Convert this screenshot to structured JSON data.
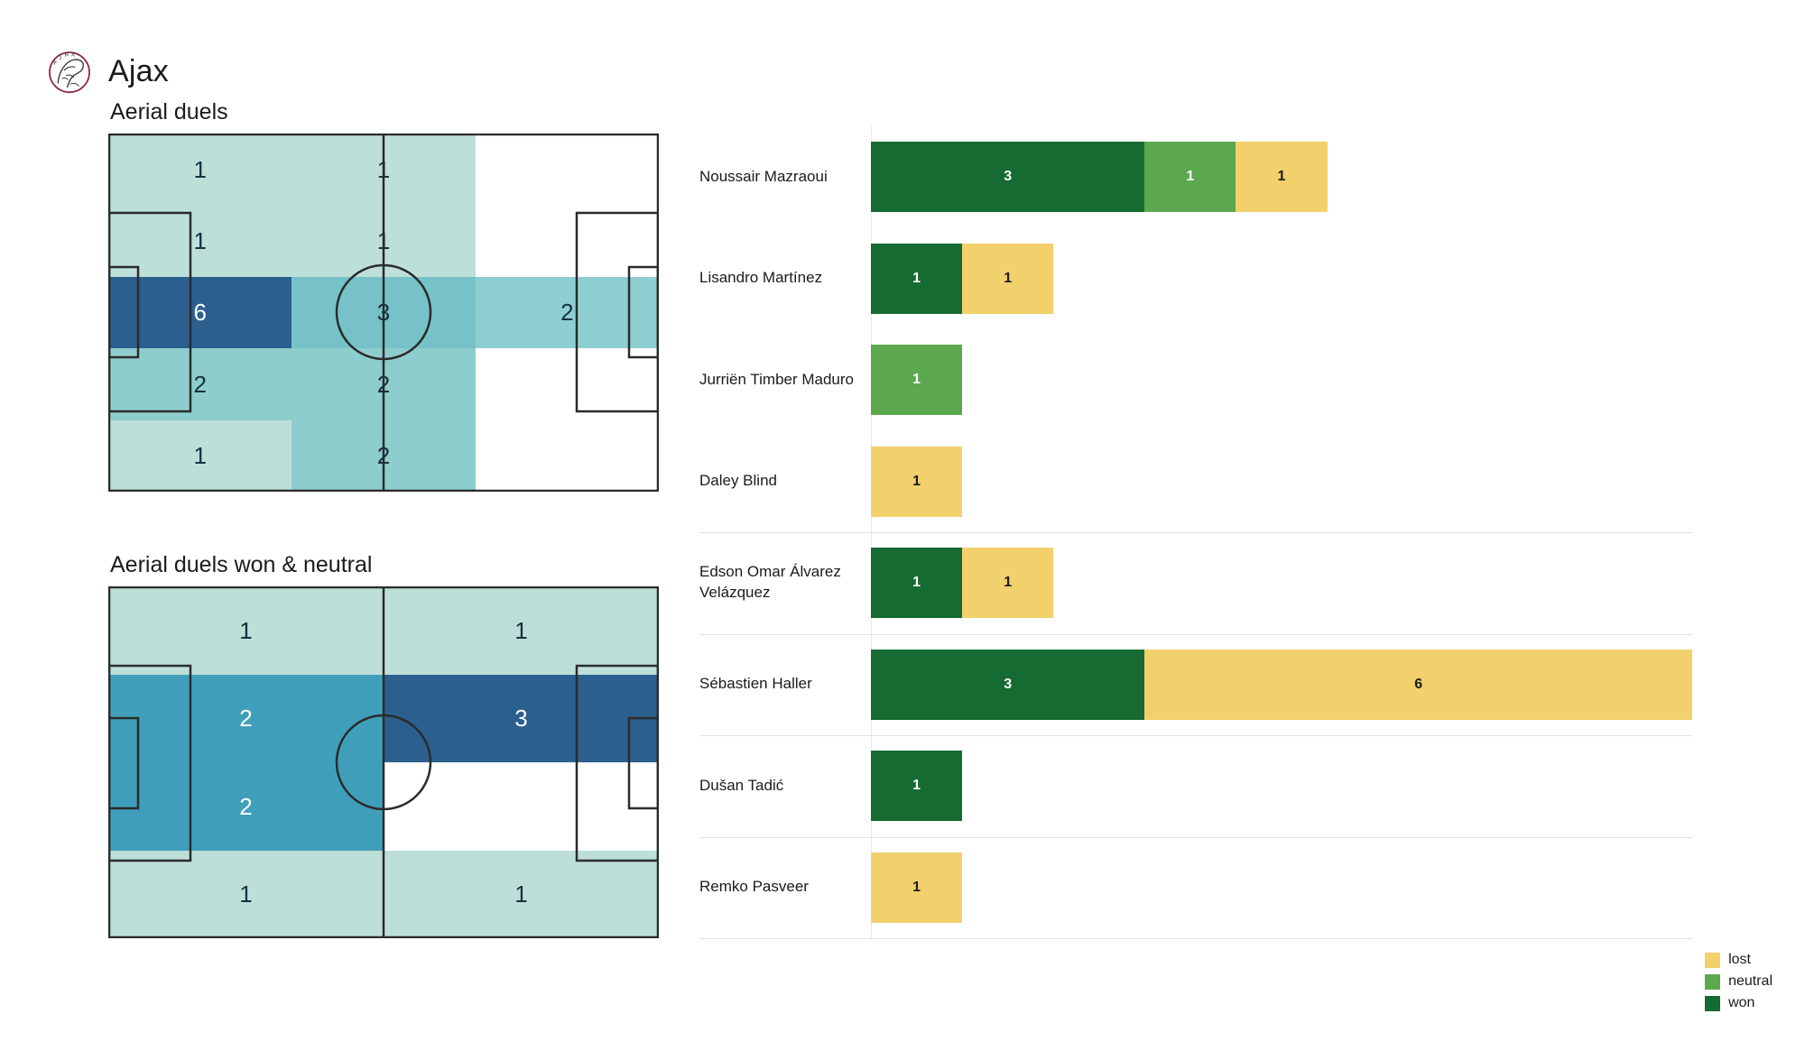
{
  "header": {
    "team_name": "Ajax",
    "crest_icon": "ajax-crest-icon",
    "crest_ring_color": "#8C2741",
    "crest_line_color": "#3a3a3a"
  },
  "pitches": [
    {
      "id": "aerial-duels",
      "title": "Aerial duels",
      "rows": 5,
      "cols": 3,
      "cells": [
        {
          "r": 0,
          "c": 0,
          "v": "1",
          "color": "#BCE0D8",
          "text": "dark"
        },
        {
          "r": 0,
          "c": 1,
          "v": "1",
          "color": "#BCE0D8",
          "text": "dark"
        },
        {
          "r": 0,
          "c": 2,
          "v": "",
          "color": "transparent",
          "text": "dark"
        },
        {
          "r": 1,
          "c": 0,
          "v": "1",
          "color": "#BCE0D8",
          "text": "dark"
        },
        {
          "r": 1,
          "c": 1,
          "v": "1",
          "color": "#BCE0D8",
          "text": "dark"
        },
        {
          "r": 1,
          "c": 2,
          "v": "",
          "color": "transparent",
          "text": "dark"
        },
        {
          "r": 2,
          "c": 0,
          "v": "6",
          "color": "#2B5F8E",
          "text": "light"
        },
        {
          "r": 2,
          "c": 1,
          "v": "3",
          "color": "#76C2C8",
          "text": "dark"
        },
        {
          "r": 2,
          "c": 2,
          "v": "2",
          "color": "#8ECFD2",
          "text": "dark"
        },
        {
          "r": 3,
          "c": 0,
          "v": "2",
          "color": "#8ECDCD",
          "text": "dark"
        },
        {
          "r": 3,
          "c": 1,
          "v": "2",
          "color": "#8ECDCD",
          "text": "dark"
        },
        {
          "r": 3,
          "c": 2,
          "v": "",
          "color": "transparent",
          "text": "dark"
        },
        {
          "r": 4,
          "c": 0,
          "v": "1",
          "color": "#BCE0D8",
          "text": "dark"
        },
        {
          "r": 4,
          "c": 1,
          "v": "2",
          "color": "#8ECDCD",
          "text": "dark"
        },
        {
          "r": 4,
          "c": 2,
          "v": "",
          "color": "transparent",
          "text": "dark"
        }
      ]
    },
    {
      "id": "aerial-duels-won-neutral",
      "title": "Aerial duels won & neutral",
      "rows": 4,
      "cols": 2,
      "cells": [
        {
          "r": 0,
          "c": 0,
          "v": "1",
          "color": "#BCE0D8",
          "text": "dark"
        },
        {
          "r": 0,
          "c": 1,
          "v": "1",
          "color": "#BCE0D8",
          "text": "dark"
        },
        {
          "r": 1,
          "c": 0,
          "v": "2",
          "color": "#3F9FBA",
          "text": "light"
        },
        {
          "r": 1,
          "c": 1,
          "v": "3",
          "color": "#2B5F8E",
          "text": "light"
        },
        {
          "r": 2,
          "c": 0,
          "v": "2",
          "color": "#3F9FBA",
          "text": "light"
        },
        {
          "r": 2,
          "c": 1,
          "v": "",
          "color": "transparent",
          "text": "dark"
        },
        {
          "r": 3,
          "c": 0,
          "v": "1",
          "color": "#BCE0D8",
          "text": "dark"
        },
        {
          "r": 3,
          "c": 1,
          "v": "1",
          "color": "#BCE0D8",
          "text": "dark"
        }
      ]
    }
  ],
  "chart_data": {
    "type": "bar",
    "orientation": "horizontal",
    "stacked": true,
    "title": "",
    "xlabel": "",
    "ylabel": "",
    "grid": false,
    "legend_position": "bottom-right",
    "max_total": 9,
    "series": [
      {
        "name": "won",
        "color": "#156B32"
      },
      {
        "name": "neutral",
        "color": "#5CA84F"
      },
      {
        "name": "lost",
        "color": "#F2D06B"
      }
    ],
    "categories": [
      "Noussair Mazraoui",
      "Lisandro Martínez",
      "Jurriën Timber Maduro",
      "Daley Blind",
      "Edson Omar Álvarez Velázquez",
      "Sébastien Haller",
      "Dušan Tadić",
      "Remko Pasveer"
    ],
    "rows": [
      {
        "player": "Noussair Mazraoui",
        "won": 3,
        "neutral": 1,
        "lost": 1
      },
      {
        "player": "Lisandro Martínez",
        "won": 1,
        "neutral": 0,
        "lost": 1
      },
      {
        "player": "Jurriën Timber Maduro",
        "won": 0,
        "neutral": 1,
        "lost": 0
      },
      {
        "player": "Daley Blind",
        "won": 0,
        "neutral": 0,
        "lost": 1
      },
      {
        "player": "Edson Omar Álvarez Velázquez",
        "won": 1,
        "neutral": 0,
        "lost": 1
      },
      {
        "player": "Sébastien Haller",
        "won": 3,
        "neutral": 0,
        "lost": 6
      },
      {
        "player": "Dušan Tadić",
        "won": 1,
        "neutral": 0,
        "lost": 0
      },
      {
        "player": "Remko Pasveer",
        "won": 0,
        "neutral": 0,
        "lost": 1
      }
    ]
  },
  "legend": {
    "items": [
      {
        "label": "lost",
        "color": "#F2D06B"
      },
      {
        "label": "neutral",
        "color": "#5CA84F"
      },
      {
        "label": "won",
        "color": "#156B32"
      }
    ]
  }
}
